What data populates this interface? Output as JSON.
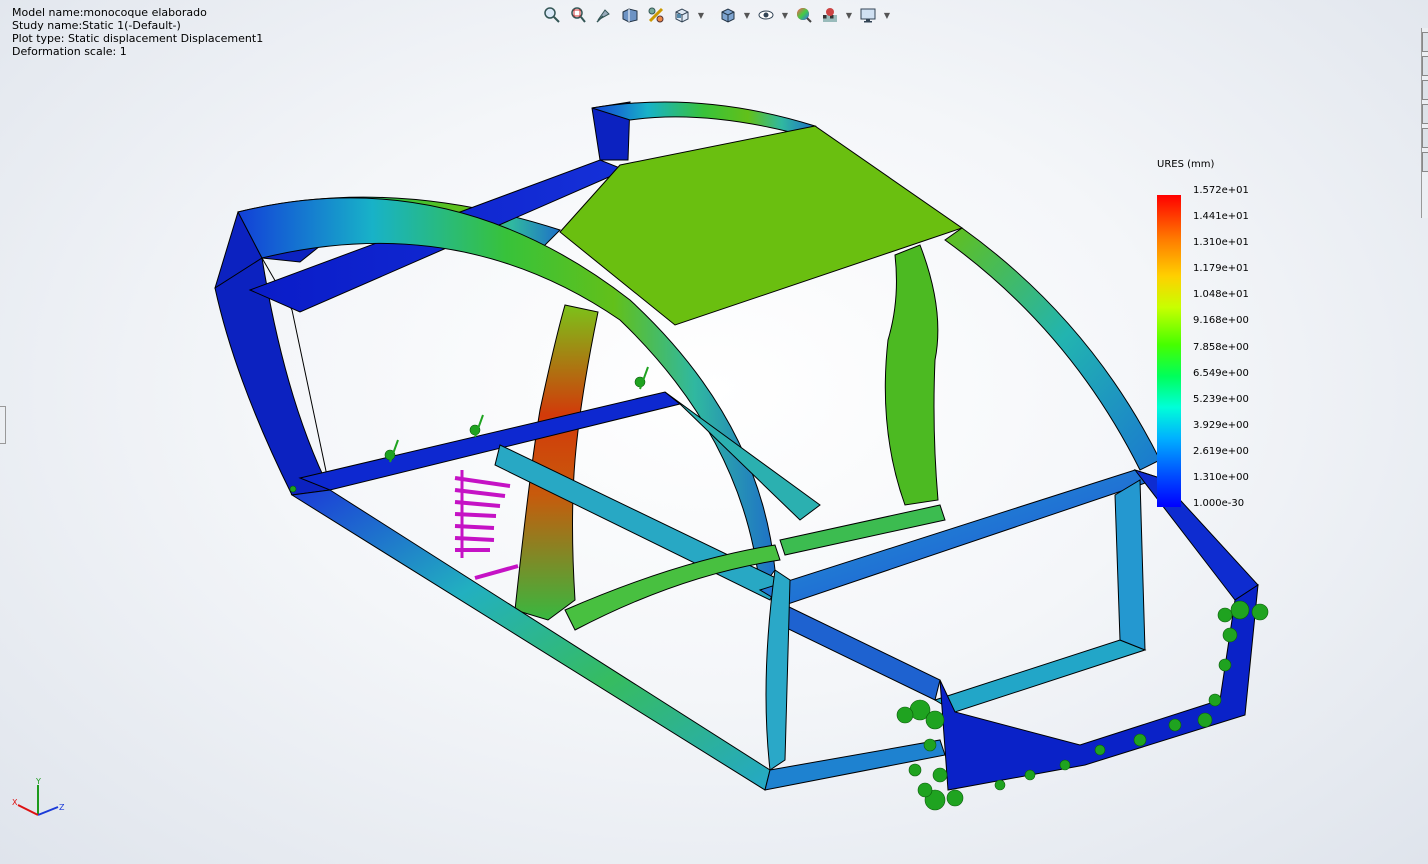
{
  "info": {
    "model_name": "Model name:monocoque elaborado",
    "study_name": "Study name:Static 1(-Default-)",
    "plot_type": "Plot type: Static displacement Displacement1",
    "deformation": "Deformation scale: 1"
  },
  "toolbar": {
    "icons": [
      "zoom-to-fit-icon",
      "zoom-to-area-icon",
      "previous-view-icon",
      "section-view-icon",
      "dynamic-annotation-icon",
      "view-orientation-icon",
      "display-style-icon",
      "hide-show-items-icon",
      "edit-appearance-icon",
      "apply-scene-icon",
      "view-settings-icon"
    ]
  },
  "legend": {
    "title": "URES (mm)",
    "labels": [
      "1.572e+01",
      "1.441e+01",
      "1.310e+01",
      "1.179e+01",
      "1.048e+01",
      "9.168e+00",
      "7.858e+00",
      "6.549e+00",
      "5.239e+00",
      "3.929e+00",
      "2.619e+00",
      "1.310e+00",
      "1.000e-30"
    ],
    "colors": [
      "#ff0000",
      "#ff7a00",
      "#ffd000",
      "#c8ff00",
      "#46ff00",
      "#00ff5a",
      "#00ffd8",
      "#00b0ff",
      "#004cff",
      "#0000ff"
    ]
  },
  "triad": {
    "x": "X",
    "y": "Y",
    "z": "Z"
  }
}
